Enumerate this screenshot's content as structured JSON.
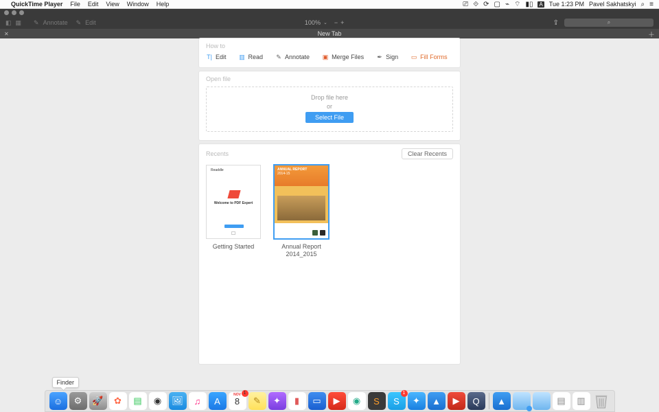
{
  "menubar": {
    "app_name": "QuickTime Player",
    "items": [
      "File",
      "Edit",
      "View",
      "Window",
      "Help"
    ],
    "clock": "Tue 1:23 PM",
    "user": "Pavel Sakhatskyi"
  },
  "toolbar": {
    "annotate": "Annotate",
    "edit": "Edit",
    "zoom": "100%",
    "search_placeholder": "⌕"
  },
  "tabbar": {
    "title": "New Tab"
  },
  "howto": {
    "label": "How to",
    "items": [
      {
        "name": "edit",
        "label": "Edit"
      },
      {
        "name": "read",
        "label": "Read"
      },
      {
        "name": "annotate",
        "label": "Annotate"
      },
      {
        "name": "merge",
        "label": "Merge Files"
      },
      {
        "name": "sign",
        "label": "Sign"
      },
      {
        "name": "fill",
        "label": "Fill Forms"
      }
    ]
  },
  "openfile": {
    "label": "Open file",
    "drop": "Drop file here",
    "or": "or",
    "select": "Select File"
  },
  "recents": {
    "label": "Recents",
    "clear": "Clear Recents",
    "items": [
      {
        "title": "Getting Started",
        "thumb_heading": "Welcome to PDF Expert"
      },
      {
        "title": "Annual Report 2014_2015",
        "thumb_heading": "ANNUAL REPORT",
        "thumb_sub": "2014-15"
      }
    ]
  },
  "dock": {
    "tooltip": "Finder",
    "icons": [
      {
        "name": "finder",
        "bg": "linear-gradient(#4aa3ff,#1b6fe0)",
        "glyph": "☺"
      },
      {
        "name": "system-preferences",
        "bg": "linear-gradient(#9a9a9a,#6d6d6d)",
        "glyph": "⚙"
      },
      {
        "name": "launchpad",
        "bg": "linear-gradient(#cfcfcf,#8c8c8c)",
        "glyph": "🚀"
      },
      {
        "name": "photos",
        "bg": "#fff",
        "glyph": "✿",
        "fg": "#ff6b4a"
      },
      {
        "name": "numbers",
        "bg": "#fff",
        "glyph": "▤",
        "fg": "#34c759"
      },
      {
        "name": "activity-monitor",
        "bg": "#fff",
        "glyph": "◉",
        "fg": "#333"
      },
      {
        "name": "preview",
        "bg": "linear-gradient(#49b1f2,#1a8be0)",
        "glyph": "🖼"
      },
      {
        "name": "itunes",
        "bg": "#fff",
        "glyph": "♫",
        "fg": "#ff2d87"
      },
      {
        "name": "app-store",
        "bg": "linear-gradient(#39a5ff,#1b79e6)",
        "glyph": "A"
      },
      {
        "name": "calendar",
        "bg": "#fff",
        "glyph": "8",
        "fg": "#333",
        "badge": "1",
        "top": "NOV"
      },
      {
        "name": "notes",
        "bg": "linear-gradient(#fff1a0,#ffe15a)",
        "glyph": "✎",
        "fg": "#b58a1a"
      },
      {
        "name": "feedback",
        "bg": "linear-gradient(#b06bff,#7a3fe0)",
        "glyph": "✦"
      },
      {
        "name": "charts",
        "bg": "#fff",
        "glyph": "▮",
        "fg": "#e05a5a"
      },
      {
        "name": "keynote",
        "bg": "linear-gradient(#3f8df0,#1a5fd0)",
        "glyph": "▭"
      },
      {
        "name": "pdf-expert-1",
        "bg": "linear-gradient(#ff4d3a,#d62a1a)",
        "glyph": "▶"
      },
      {
        "name": "chrome",
        "bg": "#fff",
        "glyph": "◉",
        "fg": "#2a8"
      },
      {
        "name": "sublime",
        "bg": "#3a3a3a",
        "glyph": "S",
        "fg": "#ff9d2a"
      },
      {
        "name": "skype",
        "bg": "linear-gradient(#3ac6ff,#1a9fe6)",
        "glyph": "S",
        "badge": "1"
      },
      {
        "name": "safari",
        "bg": "linear-gradient(#4ab6ff,#1a7fe0)",
        "glyph": "✦"
      },
      {
        "name": "arrow-app-1",
        "bg": "linear-gradient(#3f9df2,#1a6fd0)",
        "glyph": "▲"
      },
      {
        "name": "pdf-expert-2",
        "bg": "linear-gradient(#ef4a3a,#c22a1a)",
        "glyph": "▶"
      },
      {
        "name": "quicktime",
        "bg": "linear-gradient(#5a6a8a,#2a3a5a)",
        "glyph": "Q"
      }
    ],
    "right_icons": [
      {
        "name": "arrow-app-2",
        "bg": "linear-gradient(#3f9df2,#1a6fd0)",
        "glyph": "▲"
      },
      {
        "name": "folder-1",
        "bg": "linear-gradient(#bfe3ff,#6fb6ef)",
        "glyph": "",
        "badge": "●"
      },
      {
        "name": "folder-2",
        "bg": "linear-gradient(#bfe3ff,#6fb6ef)",
        "glyph": ""
      },
      {
        "name": "stack-1",
        "bg": "#fff",
        "glyph": "▤",
        "fg": "#888"
      },
      {
        "name": "stack-2",
        "bg": "#fff",
        "glyph": "▥",
        "fg": "#888"
      }
    ]
  }
}
